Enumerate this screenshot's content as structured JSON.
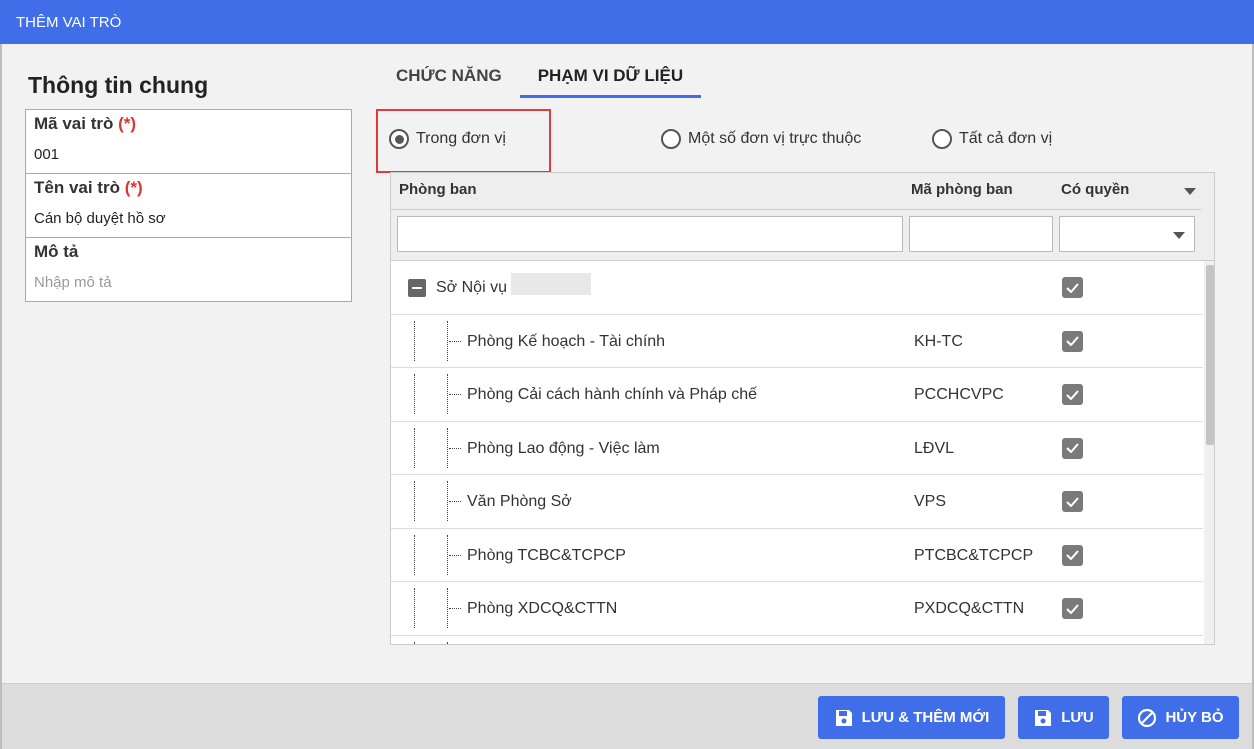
{
  "dialog": {
    "title": "THÊM VAI TRÒ"
  },
  "general": {
    "title": "Thông tin chung",
    "code_label": "Mã vai trò",
    "code_required": "(*)",
    "code_value": "001",
    "name_label": "Tên vai trò",
    "name_required": "(*)",
    "name_value": "Cán bộ duyệt hồ sơ",
    "desc_label": "Mô tả",
    "desc_placeholder": "Nhập mô tả"
  },
  "tabs": [
    {
      "label": "CHỨC NĂNG",
      "active": false
    },
    {
      "label": "PHẠM VI DỮ LIỆU",
      "active": true
    }
  ],
  "scope_options": [
    {
      "label": "Trong đơn vị",
      "selected": true
    },
    {
      "label": "Một số đơn vị trực thuộc",
      "selected": false
    },
    {
      "label": "Tất cả đơn vị",
      "selected": false
    }
  ],
  "grid": {
    "columns": [
      "Phòng ban",
      "Mã phòng ban",
      "Có quyền"
    ],
    "rows": [
      {
        "name": "Sở Nội vụ H",
        "code": "",
        "checked": true,
        "level": 0
      },
      {
        "name": "Phòng Kế hoạch - Tài chính",
        "code": "KH-TC",
        "checked": true,
        "level": 1
      },
      {
        "name": "Phòng Cải cách hành chính và Pháp chế",
        "code": "PCCHCVPC",
        "checked": true,
        "level": 1
      },
      {
        "name": "Phòng Lao động - Việc làm",
        "code": "LĐVL",
        "checked": true,
        "level": 1
      },
      {
        "name": "Văn Phòng Sở",
        "code": "VPS",
        "checked": true,
        "level": 1
      },
      {
        "name": "Phòng TCBC&TCPCP",
        "code": "PTCBC&TCPCP",
        "checked": true,
        "level": 1
      },
      {
        "name": "Phòng XDCQ&CTTN",
        "code": "PXDCQ&CTTN",
        "checked": true,
        "level": 1
      }
    ]
  },
  "footer": {
    "save_new": "LƯU & THÊM MỚI",
    "save": "LƯU",
    "cancel": "HỦY BỎ"
  },
  "colors": {
    "accent": "#3f6ee8",
    "required": "#d9372f",
    "highlight": "#e0393e"
  }
}
